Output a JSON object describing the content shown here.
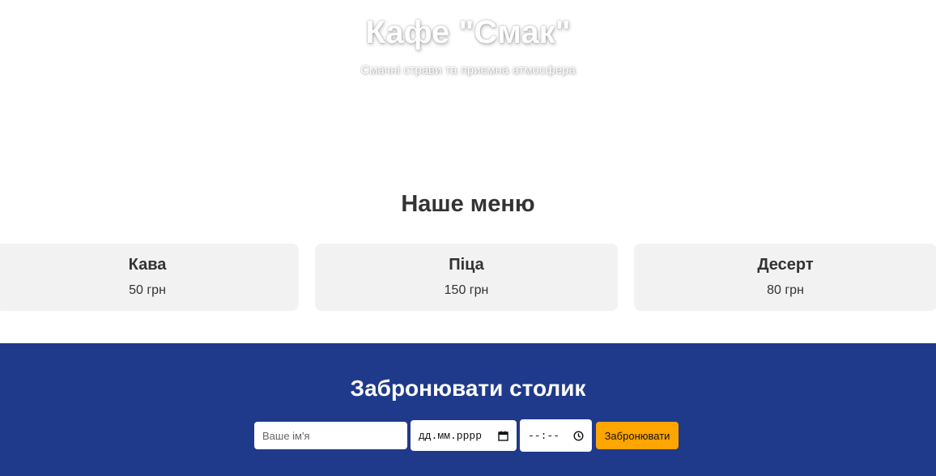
{
  "hero": {
    "title": "Кафе \"Смак\"",
    "subtitle": "Смачні страви та приємна атмосфера"
  },
  "menu": {
    "title": "Наше меню",
    "items": [
      {
        "name": "Кава",
        "price": "50 грн"
      },
      {
        "name": "Піца",
        "price": "150 грн"
      },
      {
        "name": "Десерт",
        "price": "80 грн"
      }
    ]
  },
  "booking": {
    "title": "Забронювати столик",
    "name_placeholder": "Ваше ім'я",
    "date_placeholder": "дд.мм.рррр",
    "time_placeholder": "--:--",
    "submit_label": "Забронювати"
  },
  "colors": {
    "booking_background": "#1f3a8a",
    "submit_button": "#ffa500",
    "card_background": "#f2f2f2"
  },
  "icons": {
    "date": "calendar-icon",
    "time": "clock-icon"
  }
}
